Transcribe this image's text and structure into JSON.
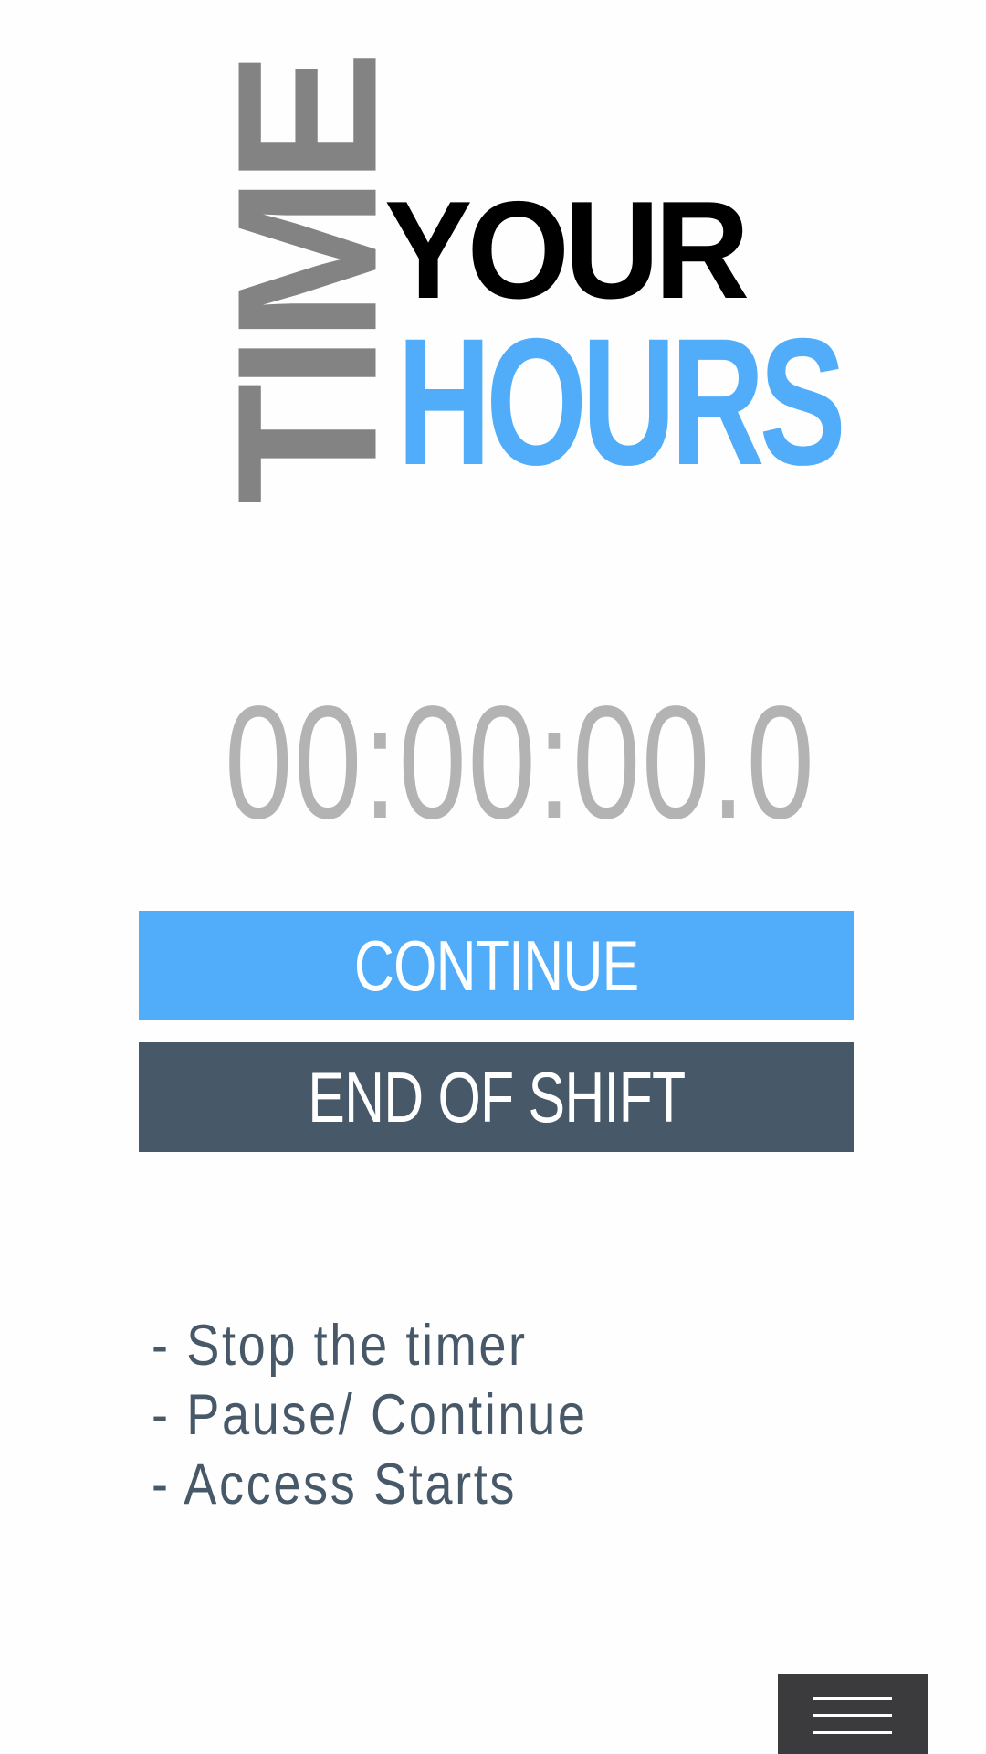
{
  "logo": {
    "word_time": "TIME",
    "word_your": "YOUR",
    "word_hours": "HOURS",
    "colors": {
      "time": "#838383",
      "your": "#000000",
      "hours": "#51acfa"
    }
  },
  "timer": {
    "display": "00:00:00.0",
    "color": "#b3b3b3"
  },
  "buttons": {
    "continue_label": "CONTINUE",
    "end_shift_label": "END OF SHIFT",
    "continue_color": "#51acfa",
    "end_shift_color": "#475868"
  },
  "info": {
    "items": [
      "- Stop the timer",
      "- Pause/ Continue",
      "- Access Starts"
    ]
  },
  "menu": {
    "icon": "hamburger-menu-icon",
    "background": "#3b3b3d"
  }
}
